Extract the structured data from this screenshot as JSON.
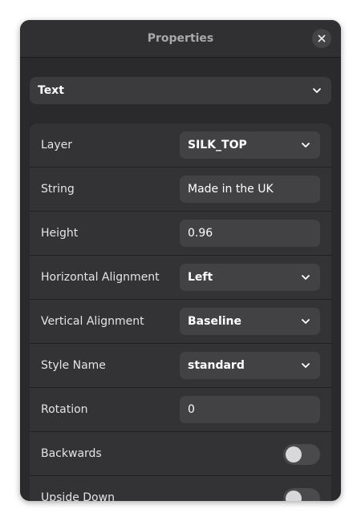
{
  "window": {
    "title": "Properties"
  },
  "object_type": {
    "selected": "Text"
  },
  "properties": {
    "layer": {
      "label": "Layer",
      "value": "SILK_TOP"
    },
    "string": {
      "label": "String",
      "value": "Made in the UK"
    },
    "height": {
      "label": "Height",
      "value": "0.96"
    },
    "horizontal_alignment": {
      "label": "Horizontal Alignment",
      "value": "Left"
    },
    "vertical_alignment": {
      "label": "Vertical Alignment",
      "value": "Baseline"
    },
    "style_name": {
      "label": "Style Name",
      "value": "standard"
    },
    "rotation": {
      "label": "Rotation",
      "value": "0"
    },
    "backwards": {
      "label": "Backwards",
      "value": false
    },
    "upside_down": {
      "label": "Upside Down",
      "value": false
    }
  },
  "icons": {
    "close": "close-icon",
    "dropdown": "chevron-down-icon"
  }
}
